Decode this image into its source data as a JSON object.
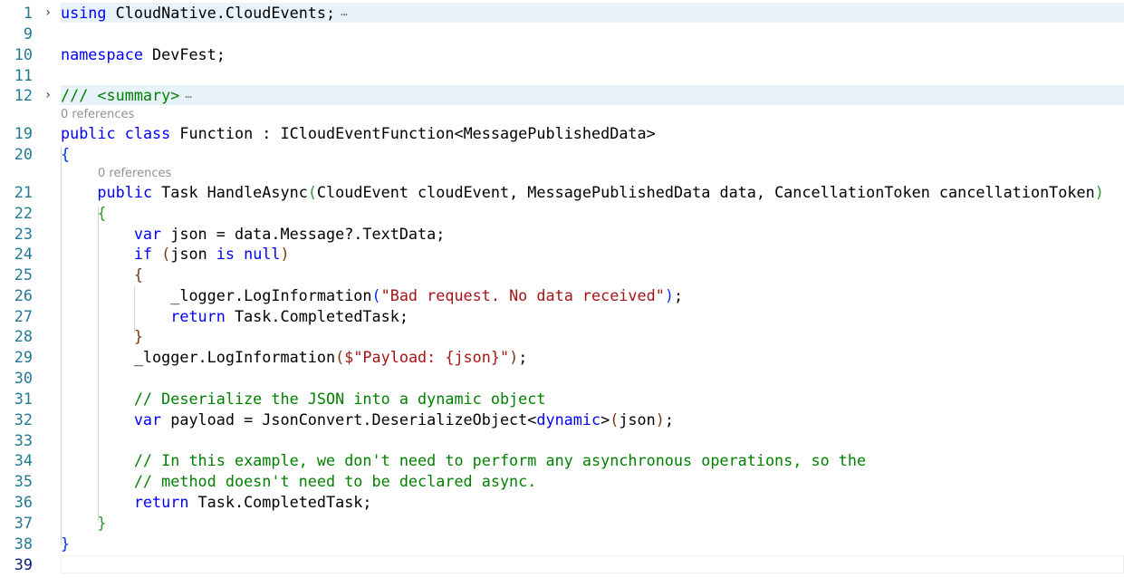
{
  "editor": {
    "codelens_text": "0 references",
    "lines": [
      {
        "number": "1",
        "folded": true,
        "highlighted": true,
        "segments": [
          [
            "kw",
            "using"
          ],
          [
            "t",
            " CloudNative.CloudEvents;"
          ]
        ]
      },
      {
        "number": "9",
        "segments": []
      },
      {
        "number": "10",
        "segments": [
          [
            "kw",
            "namespace"
          ],
          [
            "t",
            " DevFest;"
          ]
        ]
      },
      {
        "number": "11",
        "segments": []
      },
      {
        "number": "12",
        "folded": true,
        "highlighted": true,
        "segments": [
          [
            "cm",
            "/// <summary>"
          ]
        ]
      },
      {
        "number": "19",
        "codelens": true,
        "segments": [
          [
            "kw",
            "public"
          ],
          [
            "t",
            " "
          ],
          [
            "kw",
            "class"
          ],
          [
            "t",
            " Function : ICloudEventFunction<MessagePublishedData>"
          ]
        ]
      },
      {
        "number": "20",
        "segments": [
          [
            "p1",
            "{"
          ]
        ]
      },
      {
        "number": "21",
        "codelens": true,
        "segments": [
          [
            "t",
            "    "
          ],
          [
            "kw",
            "public"
          ],
          [
            "t",
            " Task HandleAsync"
          ],
          [
            "p2",
            "("
          ],
          [
            "t",
            "CloudEvent cloudEvent, MessagePublishedData data, CancellationToken cancellationToken"
          ],
          [
            "p2",
            ")"
          ]
        ]
      },
      {
        "number": "22",
        "segments": [
          [
            "t",
            "    "
          ],
          [
            "p2",
            "{"
          ]
        ]
      },
      {
        "number": "23",
        "segments": [
          [
            "t",
            "        "
          ],
          [
            "kw",
            "var"
          ],
          [
            "t",
            " json = data.Message?.TextData;"
          ]
        ]
      },
      {
        "number": "24",
        "segments": [
          [
            "t",
            "        "
          ],
          [
            "kw",
            "if"
          ],
          [
            "t",
            " "
          ],
          [
            "p3",
            "("
          ],
          [
            "t",
            "json "
          ],
          [
            "kw",
            "is"
          ],
          [
            "t",
            " "
          ],
          [
            "kw",
            "null"
          ],
          [
            "p3",
            ")"
          ]
        ]
      },
      {
        "number": "25",
        "segments": [
          [
            "t",
            "        "
          ],
          [
            "p3",
            "{"
          ]
        ]
      },
      {
        "number": "26",
        "segments": [
          [
            "t",
            "            _logger.LogInformation"
          ],
          [
            "p1",
            "("
          ],
          [
            "str",
            "\"Bad request. No data received\""
          ],
          [
            "p1",
            ")"
          ],
          [
            "t",
            ";"
          ]
        ]
      },
      {
        "number": "27",
        "segments": [
          [
            "t",
            "            "
          ],
          [
            "kw",
            "return"
          ],
          [
            "t",
            " Task.CompletedTask;"
          ]
        ]
      },
      {
        "number": "28",
        "segments": [
          [
            "t",
            "        "
          ],
          [
            "p3",
            "}"
          ]
        ]
      },
      {
        "number": "29",
        "segments": [
          [
            "t",
            "        _logger.LogInformation"
          ],
          [
            "p3",
            "("
          ],
          [
            "str",
            "$\"Payload: {json}\""
          ],
          [
            "p3",
            ")"
          ],
          [
            "t",
            ";"
          ]
        ]
      },
      {
        "number": "30",
        "segments": []
      },
      {
        "number": "31",
        "segments": [
          [
            "t",
            "        "
          ],
          [
            "cm",
            "// Deserialize the JSON into a dynamic object"
          ]
        ]
      },
      {
        "number": "32",
        "segments": [
          [
            "t",
            "        "
          ],
          [
            "kw",
            "var"
          ],
          [
            "t",
            " payload = JsonConvert.DeserializeObject<"
          ],
          [
            "kw",
            "dynamic"
          ],
          [
            "t",
            ">"
          ],
          [
            "p3",
            "("
          ],
          [
            "t",
            "json"
          ],
          [
            "p3",
            ")"
          ],
          [
            "t",
            ";"
          ]
        ]
      },
      {
        "number": "33",
        "segments": []
      },
      {
        "number": "34",
        "segments": [
          [
            "t",
            "        "
          ],
          [
            "cm",
            "// In this example, we don't need to perform any asynchronous operations, so the"
          ]
        ]
      },
      {
        "number": "35",
        "segments": [
          [
            "t",
            "        "
          ],
          [
            "cm",
            "// method doesn't need to be declared async."
          ]
        ]
      },
      {
        "number": "36",
        "segments": [
          [
            "t",
            "        "
          ],
          [
            "kw",
            "return"
          ],
          [
            "t",
            " Task.CompletedTask;"
          ]
        ]
      },
      {
        "number": "37",
        "segments": [
          [
            "t",
            "    "
          ],
          [
            "p2",
            "}"
          ]
        ]
      },
      {
        "number": "38",
        "segments": [
          [
            "p1",
            "}"
          ]
        ]
      },
      {
        "number": "39",
        "current": true,
        "segments": []
      }
    ]
  }
}
